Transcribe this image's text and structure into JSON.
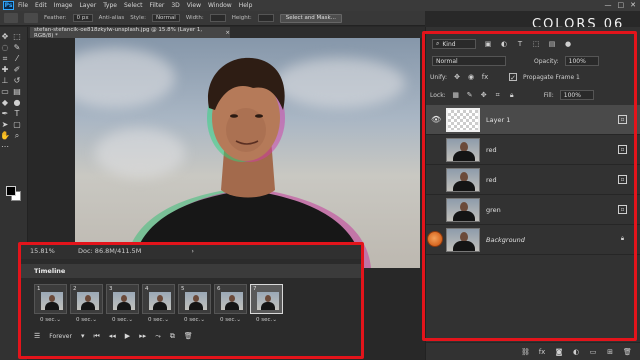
{
  "menubar": {
    "logo": "Ps",
    "items": [
      "File",
      "Edit",
      "Image",
      "Layer",
      "Type",
      "Select",
      "Filter",
      "3D",
      "View",
      "Window",
      "Help"
    ],
    "window_controls": [
      "—",
      "□",
      "✕"
    ]
  },
  "options_bar": {
    "feather_label": "Feather:",
    "feather_value": "0 px",
    "antialias_label": "Anti-alias",
    "style_label": "Style:",
    "style_value": "Normal",
    "width_label": "Width:",
    "height_label": "Height:",
    "select_mask_button": "Select and Mask..."
  },
  "document": {
    "tab_title": "stefan-stefancik-oe818zkylw-unsplash.jpg @ 15.8% (Layer 1, RGB/8) *",
    "close": "×"
  },
  "watermark": "COLORS 06",
  "timeline": {
    "zoom": "15.81%",
    "doc_info": "Doc: 86.8M/411.5M",
    "nav": "›",
    "title": "Timeline",
    "frames": [
      {
        "num": "1",
        "delay": "0 sec.⌄"
      },
      {
        "num": "2",
        "delay": "0 sec.⌄"
      },
      {
        "num": "3",
        "delay": "0 sec.⌄"
      },
      {
        "num": "4",
        "delay": "0 sec.⌄"
      },
      {
        "num": "5",
        "delay": "0 sec.⌄"
      },
      {
        "num": "6",
        "delay": "0 sec.⌄"
      },
      {
        "num": "7",
        "delay": "0 sec.⌄"
      }
    ],
    "selected_frame": 7,
    "loop": "Forever"
  },
  "layers_panel": {
    "filter_label": "Kind",
    "blend_mode": "Normal",
    "opacity_label": "Opacity:",
    "opacity_value": "100%",
    "unify_label": "Unify:",
    "propagate_label": "Propagate Frame 1",
    "lock_label": "Lock:",
    "fill_label": "Fill:",
    "fill_value": "100%",
    "layers": [
      {
        "name": "Layer 1",
        "visible": true,
        "selected": true,
        "thumb": "transparent"
      },
      {
        "name": "red",
        "visible": false,
        "selected": false,
        "thumb": "photo"
      },
      {
        "name": "red",
        "visible": false,
        "selected": false,
        "thumb": "photo"
      },
      {
        "name": "gren",
        "visible": false,
        "selected": false,
        "thumb": "photo"
      },
      {
        "name": "Background",
        "visible": true,
        "selected": false,
        "thumb": "photo",
        "locked": true
      }
    ]
  },
  "colors": {
    "highlight": "#e3141b",
    "panel_bg": "#323232",
    "app_bg": "#282828"
  }
}
